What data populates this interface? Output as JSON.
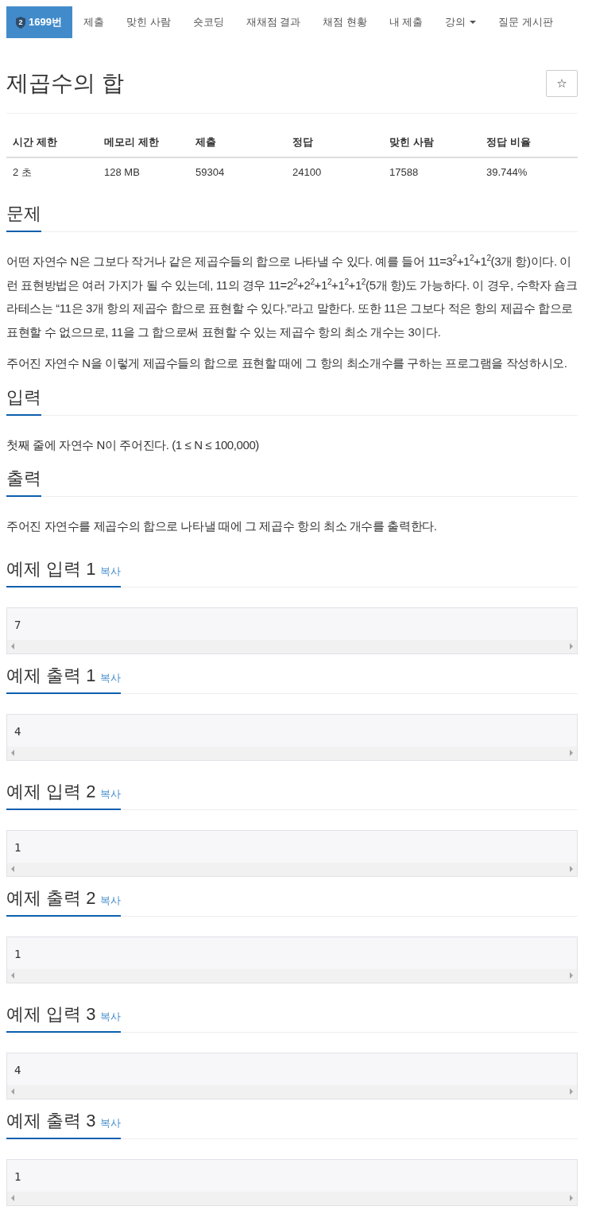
{
  "nav": {
    "items": [
      {
        "label": "1699번",
        "badge": "2",
        "selected": true,
        "dropdown": false
      },
      {
        "label": "제출",
        "selected": false,
        "dropdown": false
      },
      {
        "label": "맞힌 사람",
        "selected": false,
        "dropdown": false
      },
      {
        "label": "숏코딩",
        "selected": false,
        "dropdown": false
      },
      {
        "label": "재채점 결과",
        "selected": false,
        "dropdown": false
      },
      {
        "label": "채점 현황",
        "selected": false,
        "dropdown": false
      },
      {
        "label": "내 제출",
        "selected": false,
        "dropdown": false
      },
      {
        "label": "강의",
        "selected": false,
        "dropdown": true
      },
      {
        "label": "질문 게시판",
        "selected": false,
        "dropdown": false
      }
    ]
  },
  "title": "제곱수의 합",
  "star_button": "☆",
  "info_table": {
    "columns": [
      "시간 제한",
      "메모리 제한",
      "제출",
      "정답",
      "맞힌 사람",
      "정답 비율"
    ],
    "rows": [
      [
        "2 초",
        "128 MB",
        "59304",
        "24100",
        "17588",
        "39.744%"
      ]
    ]
  },
  "sections": [
    {
      "heading": "문제",
      "paragraphs": [
        "어떤 자연수 N은 그보다 작거나 같은 제곱수들의 합으로 나타낼 수 있다. 예를 들어 11=3$^{2}$+1$^{2}$+1$^{2}$(3개 항)이다. 이런 표현방법은 여러 가지가 될 수 있는데, 11의 경우 11=2$^{2}$+2$^{2}$+1$^{2}$+1$^{2}$+1$^{2}$(5개 항)도 가능하다. 이 경우, 수학자 숌크라테스는 “11은 3개 항의 제곱수 합으로 표현할 수 있다.”라고 말한다. 또한 11은 그보다 적은 항의 제곱수 합으로 표현할 수 없으므로, 11을 그 합으로써 표현할 수 있는 제곱수 항의 최소 개수는 3이다.",
        "주어진 자연수 N을 이렇게 제곱수들의 합으로 표현할 때에 그 항의 최소개수를 구하는 프로그램을 작성하시오."
      ]
    },
    {
      "heading": "입력",
      "paragraphs": [
        "첫째 줄에 자연수 N이 주어진다. (1 ≤ N ≤ 100,000)"
      ]
    },
    {
      "heading": "출력",
      "paragraphs": [
        "주어진 자연수를 제곱수의 합으로 나타낼 때에 그 제곱수 항의 최소 개수를 출력한다."
      ]
    }
  ],
  "samples": [
    {
      "title": "예제 입력 1",
      "copy": "복사",
      "content": "7"
    },
    {
      "title": "예제 출력 1",
      "copy": "복사",
      "content": "4"
    },
    {
      "title": "예제 입력 2",
      "copy": "복사",
      "content": "1"
    },
    {
      "title": "예제 출력 2",
      "copy": "복사",
      "content": "1"
    },
    {
      "title": "예제 입력 3",
      "copy": "복사",
      "content": "4"
    },
    {
      "title": "예제 출력 3",
      "copy": "복사",
      "content": "1"
    }
  ]
}
